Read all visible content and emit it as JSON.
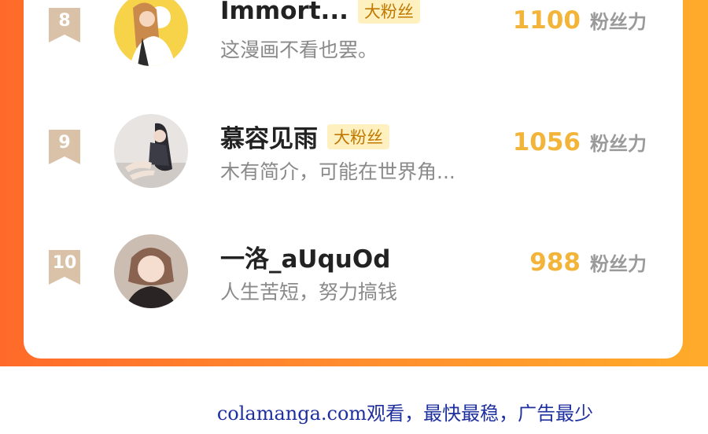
{
  "ranking": {
    "rows": [
      {
        "rank": "8",
        "username": "Immort...",
        "badge": "大粉丝",
        "bio": "这漫画不看也罢。",
        "score": "1100",
        "unit": "粉丝力"
      },
      {
        "rank": "9",
        "username": "慕容见雨",
        "badge": "大粉丝",
        "bio": "木有简介，可能在世界角...",
        "score": "1056",
        "unit": "粉丝力"
      },
      {
        "rank": "10",
        "username": "一洛_aUquOd",
        "badge": "",
        "bio": "人生苦短，努力搞钱",
        "score": "988",
        "unit": "粉丝力"
      }
    ]
  },
  "footer": {
    "text": "colamanga.com观看，最快最稳，广告最少"
  },
  "colors": {
    "frame_gradient_start": "#ff6a2a",
    "frame_gradient_end": "#ffab2a",
    "score": "#f3b43a",
    "rank_badge": "#d9c2a8",
    "footer_text": "#1e2f9e"
  }
}
